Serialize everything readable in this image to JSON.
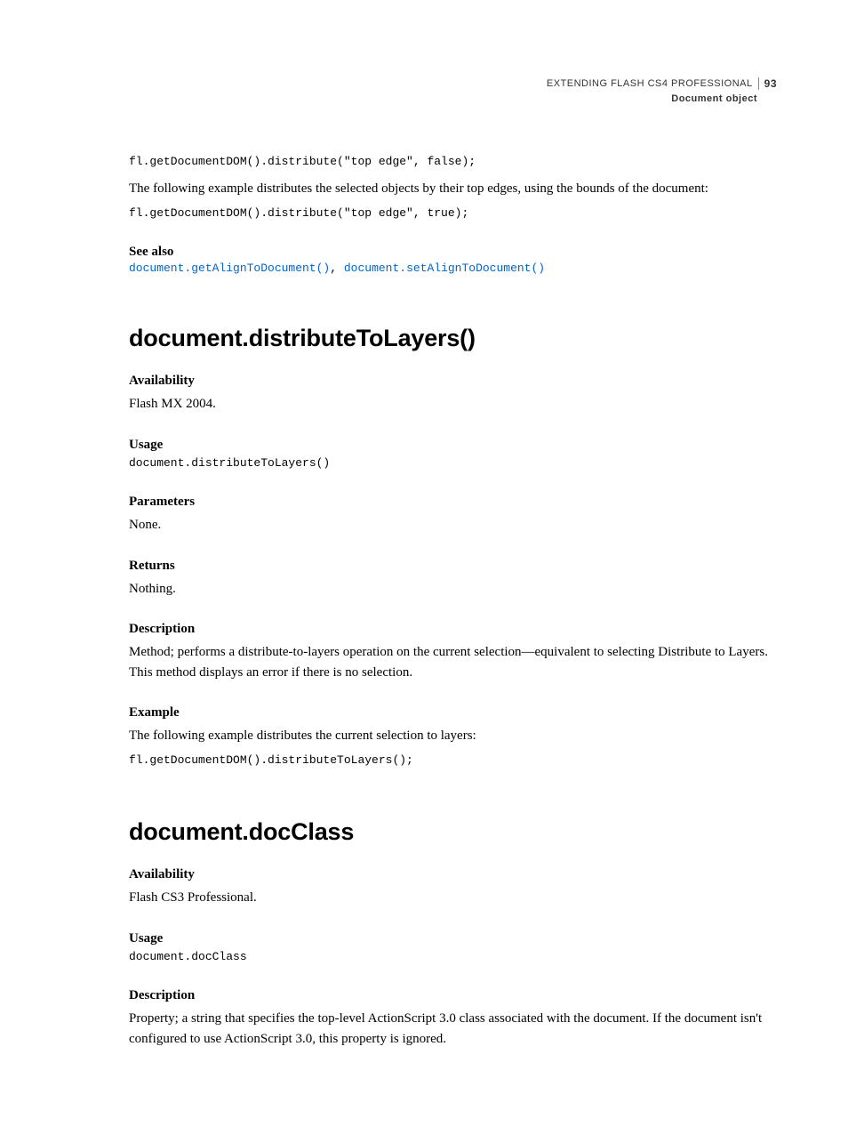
{
  "header": {
    "title": "EXTENDING FLASH CS4 PROFESSIONAL",
    "page_number": "93",
    "subtitle": "Document object"
  },
  "intro": {
    "code1": "fl.getDocumentDOM().distribute(\"top edge\", false);",
    "text1": "The following example distributes the selected objects by their top edges, using the bounds of the document:",
    "code2": "fl.getDocumentDOM().distribute(\"top edge\", true);",
    "see_also_label": "See also",
    "link1": "document.getAlignToDocument()",
    "link2": "document.setAlignToDocument()"
  },
  "section1": {
    "heading": "document.distributeToLayers()",
    "availability_label": "Availability",
    "availability_text": "Flash MX 2004.",
    "usage_label": "Usage",
    "usage_code": "document.distributeToLayers()",
    "parameters_label": "Parameters",
    "parameters_text": "None.",
    "returns_label": "Returns",
    "returns_text": "Nothing.",
    "description_label": "Description",
    "description_text": "Method; performs a distribute-to-layers operation on the current selection—equivalent to selecting Distribute to Layers. This method displays an error if there is no selection.",
    "example_label": "Example",
    "example_text": "The following example distributes the current selection to layers:",
    "example_code": "fl.getDocumentDOM().distributeToLayers();"
  },
  "section2": {
    "heading": "document.docClass",
    "availability_label": "Availability",
    "availability_text": "Flash CS3 Professional.",
    "usage_label": "Usage",
    "usage_code": "document.docClass",
    "description_label": "Description",
    "description_text": "Property; a string that specifies the top-level ActionScript 3.0 class associated with the document. If the document isn't configured to use ActionScript 3.0, this property is ignored."
  }
}
